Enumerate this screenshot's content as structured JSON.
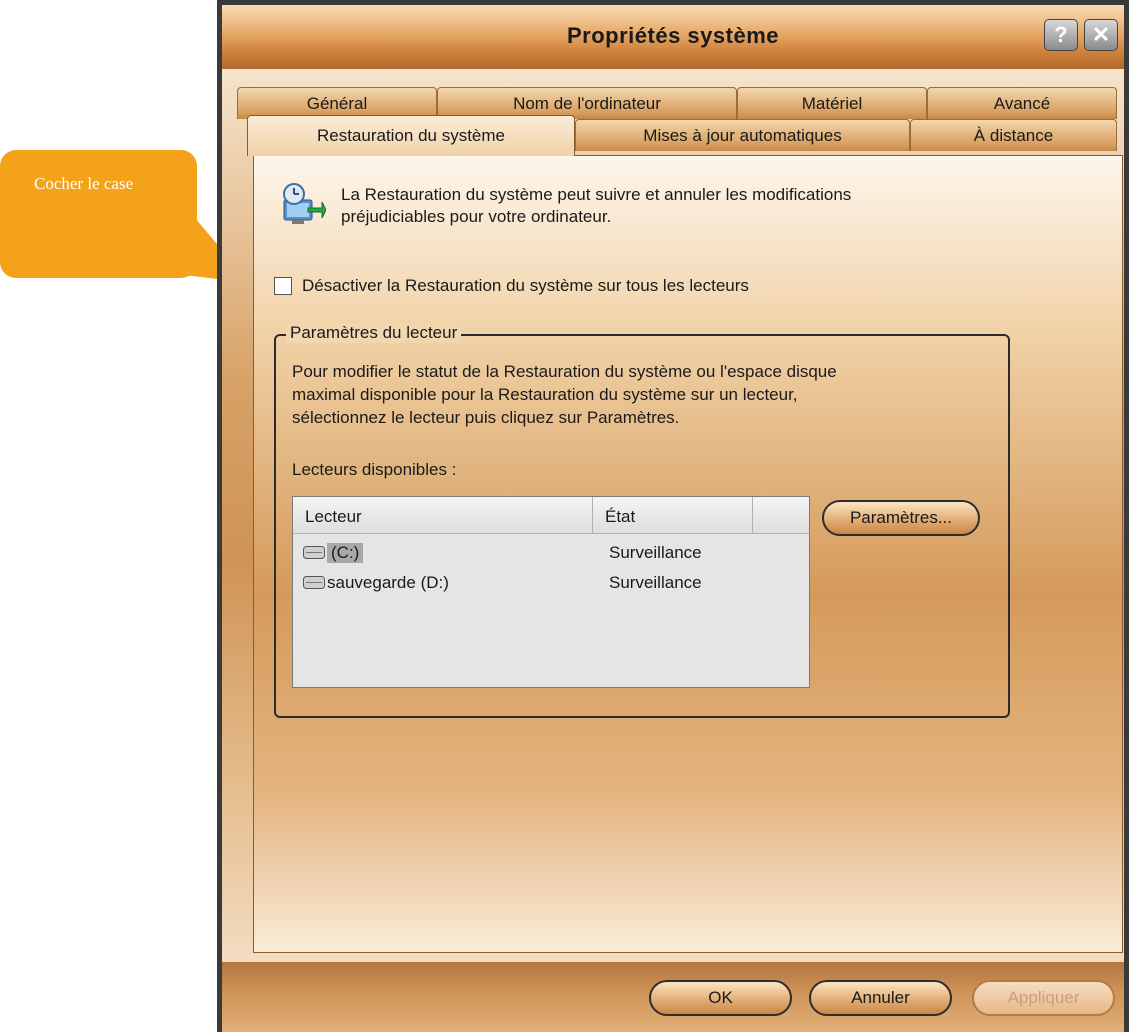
{
  "callout": {
    "text": "Cocher le case",
    "color": "#f5a21b"
  },
  "window": {
    "title": "Propriétés système",
    "help_glyph": "?",
    "close_glyph": "✕"
  },
  "tabs": {
    "row1": [
      "Général",
      "Nom de l'ordinateur",
      "Matériel",
      "Avancé"
    ],
    "row2": [
      "Restauration du système",
      "Mises à jour automatiques",
      "À distance"
    ],
    "active": "Restauration du système"
  },
  "panel": {
    "intro_line1": "La Restauration du système peut suivre et annuler les modifications",
    "intro_line2": "préjudiciables pour votre ordinateur.",
    "checkbox_label": "Désactiver la Restauration du système sur tous les lecteurs",
    "checkbox_checked": false,
    "group": {
      "legend": "Paramètres du lecteur",
      "desc_line1": "Pour modifier le statut de la Restauration du système ou l'espace disque",
      "desc_line2": "maximal disponible pour la Restauration du système sur un lecteur,",
      "desc_line3": "sélectionnez le lecteur puis cliquez sur Paramètres.",
      "available_label": "Lecteurs disponibles :",
      "columns": [
        "Lecteur",
        "État"
      ],
      "drives": [
        {
          "name": "(C:)",
          "state": "Surveillance",
          "selected": true
        },
        {
          "name": "sauvegarde (D:)",
          "state": "Surveillance",
          "selected": false
        }
      ],
      "params_button": "Paramètres..."
    }
  },
  "footer": {
    "ok": "OK",
    "cancel": "Annuler",
    "apply": "Appliquer"
  }
}
